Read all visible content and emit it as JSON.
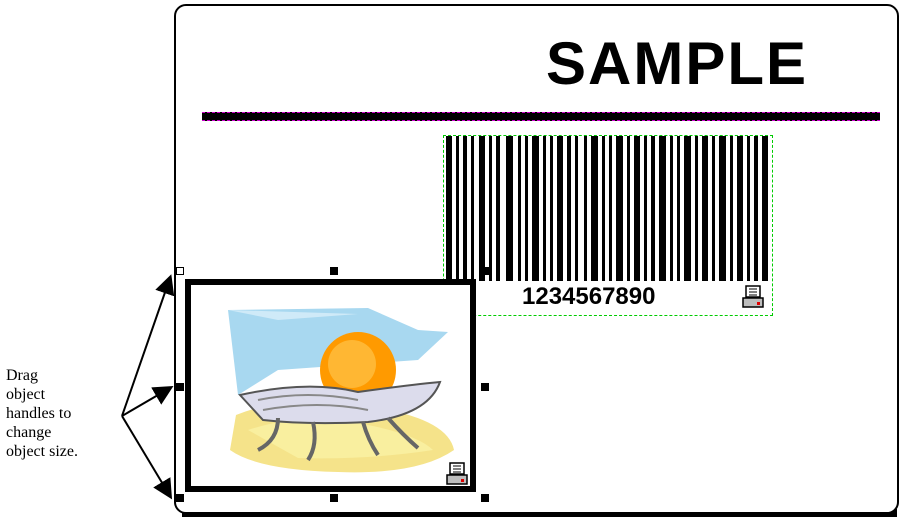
{
  "label": {
    "sample_text": "SAMPLE",
    "barcode_number": "1234567890"
  },
  "caption": {
    "lines": [
      "Drag",
      "object",
      "handles to",
      "change",
      "object size."
    ]
  },
  "icons": {
    "printer": "printer-icon",
    "picture": "beach-chair-sun-clipart"
  },
  "colors": {
    "border": "#000000",
    "rule_outline": "#cc00cc",
    "barcode_outline": "#00cc00",
    "sun": "#ff9a00",
    "sky": "#a8d8f0",
    "sand": "#f5e38a"
  }
}
